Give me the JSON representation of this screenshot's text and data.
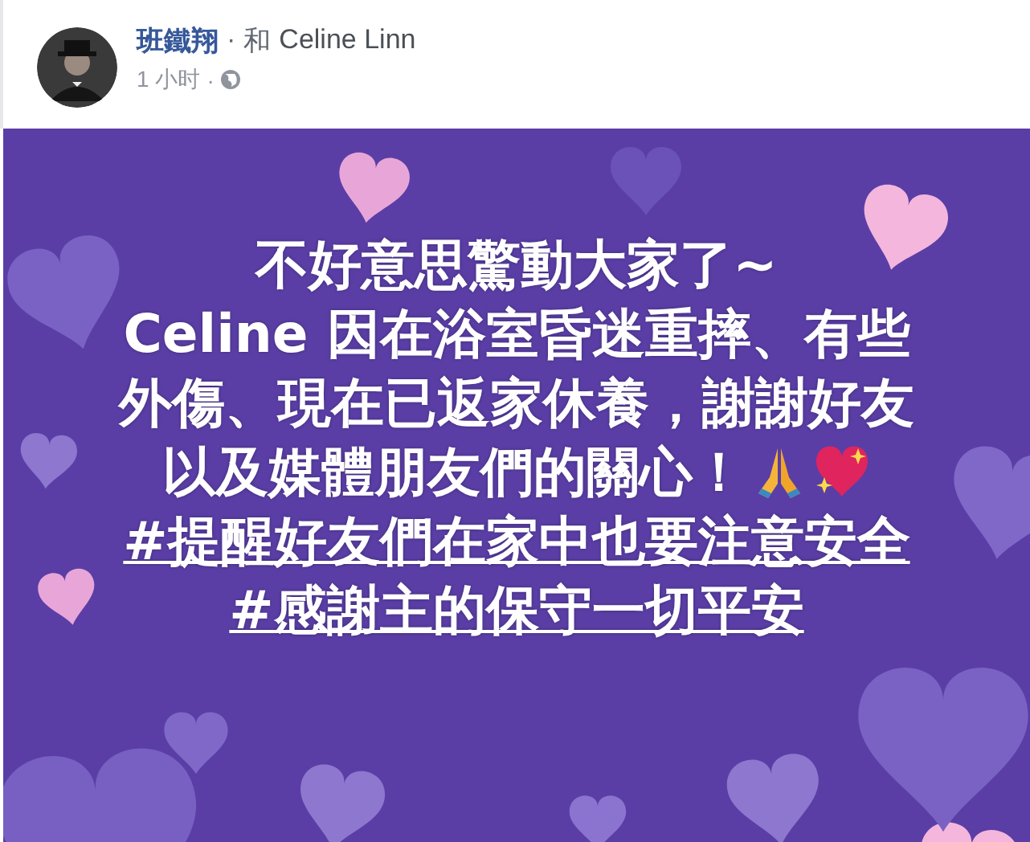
{
  "post": {
    "author": "班鐵翔",
    "separator": "·",
    "with_label": "和",
    "tagged": "Celine Linn",
    "time": "1 小时",
    "time_separator": "·"
  },
  "body": {
    "lines": [
      {
        "kind": "text",
        "text": "不好意思驚動大家了~"
      },
      {
        "kind": "text",
        "text": "Celine 因在浴室昏迷重摔、有些"
      },
      {
        "kind": "text",
        "text": "外傷、現在已返家休養，謝謝好友"
      },
      {
        "kind": "text_emoji",
        "text": "以及媒體朋友們的關心！"
      },
      {
        "kind": "hashtag",
        "text": "#提醒好友們在家中也要注意安全"
      },
      {
        "kind": "hashtag",
        "text": "#感謝主的保守一切平安"
      }
    ]
  }
}
